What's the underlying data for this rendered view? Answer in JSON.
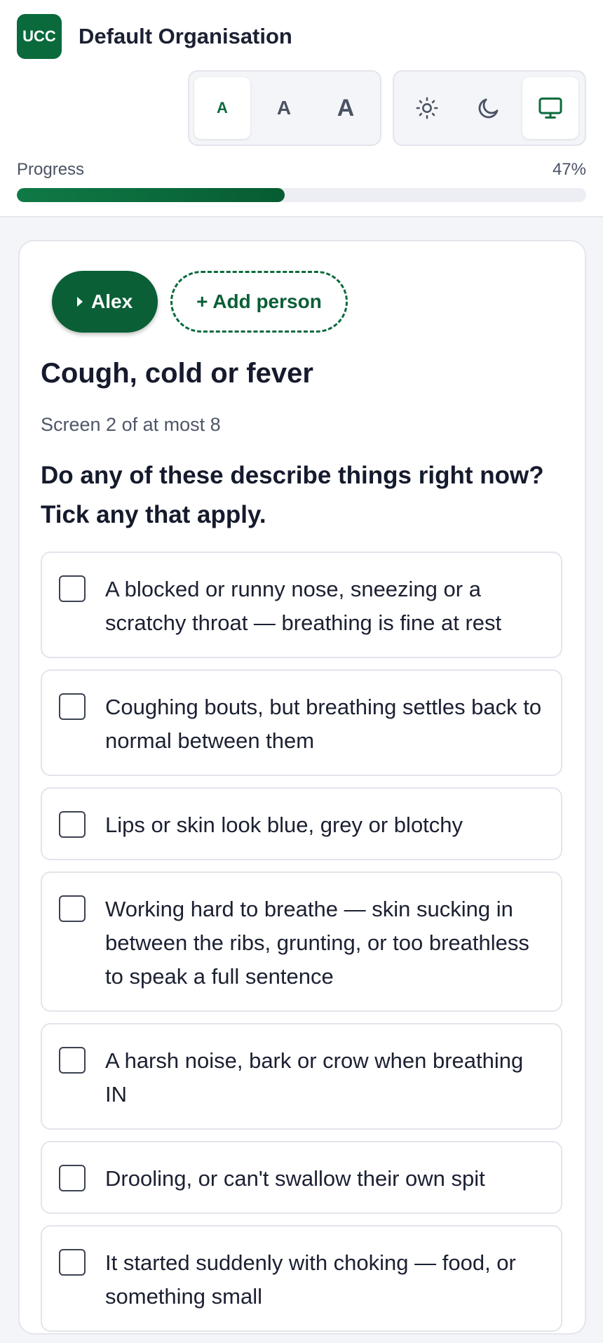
{
  "header": {
    "logo_text": "UCC",
    "org_name": "Default Organisation",
    "text_size": {
      "options": [
        "A",
        "A",
        "A"
      ],
      "selected_index": 0
    },
    "theme": {
      "options": [
        "sun-icon",
        "moon-icon",
        "monitor-icon"
      ],
      "selected_index": 2
    },
    "progress": {
      "label": "Progress",
      "percent_text": "47%",
      "value": 0.47
    }
  },
  "card": {
    "people": {
      "current": "Alex",
      "add_label": "+ Add person"
    },
    "title": "Cough, cold or fever",
    "screen_count": "Screen 2 of at most 8",
    "prompt": "Do any of these describe things right now? Tick any that apply.",
    "options": [
      "A blocked or runny nose, sneezing or a scratchy throat — breathing is fine at rest",
      "Coughing bouts, but breathing settles back to normal between them",
      "Lips or skin look blue, grey or blotchy",
      "Working hard to breathe — skin sucking in between the ribs, grunting, or too breathless to speak a full sentence",
      "A harsh noise, bark or crow when breathing IN",
      "Drooling, or can't swallow their own spit",
      "It started suddenly with choking — food, or something small"
    ]
  },
  "colors": {
    "brand": "#0a6a3c",
    "brand_dark": "#0a5f36",
    "background": "#f4f5f8"
  }
}
